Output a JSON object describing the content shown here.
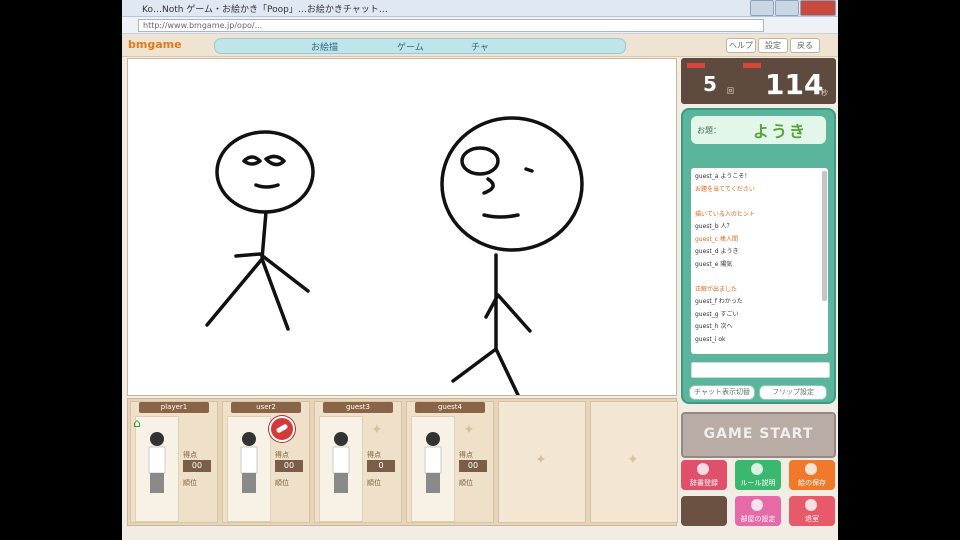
{
  "browser": {
    "title": "Ko…Noth ゲーム・お絵かき「Poop」…お絵かきチャット…",
    "url": "http://www.bmgame.jp/opo/..."
  },
  "site": {
    "logo": "bmgame",
    "nav": [
      "お絵描",
      "ゲーム",
      "チャ"
    ],
    "top_buttons": [
      "ヘルプ",
      "設定",
      "戻る"
    ]
  },
  "game": {
    "round": "5",
    "round_unit": "回",
    "timer": "114",
    "timer_unit": "秒",
    "theme_label": "お題：",
    "theme_word": "ようき",
    "start_label": "GAME START"
  },
  "players": [
    {
      "name": "player1",
      "score": "00",
      "label_top": "得点",
      "label_bot": "順位"
    },
    {
      "name": "user2",
      "score": "00",
      "label_top": "得点",
      "label_bot": "順位"
    },
    {
      "name": "guest3",
      "score": "0",
      "label_top": "得点",
      "label_bot": "順位"
    },
    {
      "name": "guest4",
      "score": "00",
      "label_top": "得点",
      "label_bot": "順位"
    }
  ],
  "chat": [
    {
      "name": "guest_a",
      "text": "ようこそ！",
      "color": "#333333"
    },
    {
      "name": "",
      "text": "お題を当ててください",
      "color": "#e06a1a"
    },
    {
      "name": "",
      "text": "",
      "color": "#e06a1a"
    },
    {
      "name": "",
      "text": "描いている人のヒント",
      "color": "#e06a1a"
    },
    {
      "name": "guest_b",
      "text": "人？",
      "color": "#333333"
    },
    {
      "name": "guest_c",
      "text": "棒人間",
      "color": "#e06a1a"
    },
    {
      "name": "guest_d",
      "text": "ようき",
      "color": "#333333"
    },
    {
      "name": "guest_e",
      "text": "陽気",
      "color": "#333333"
    },
    {
      "name": "",
      "text": "",
      "color": "#e06a1a"
    },
    {
      "name": "",
      "text": "正解が出ました",
      "color": "#e06a1a"
    },
    {
      "name": "guest_f",
      "text": "わかった",
      "color": "#333333"
    },
    {
      "name": "guest_g",
      "text": "すごい",
      "color": "#333333"
    },
    {
      "name": "guest_h",
      "text": "次へ",
      "color": "#333333"
    },
    {
      "name": "guest_i",
      "text": "ok",
      "color": "#333333"
    }
  ],
  "chat_buttons": [
    "チャット表示切替",
    "フリップ設定"
  ],
  "actions": [
    {
      "label": "辞書登録",
      "color": "#e0506a"
    },
    {
      "label": "ルール説明",
      "color": "#3ab86e"
    },
    {
      "label": "絵の保存",
      "color": "#f07a2a"
    },
    {
      "label": "部屋の設定",
      "color": "#e66aa8"
    },
    {
      "label": "退室",
      "color": "#e65a6a"
    }
  ],
  "colors": {
    "canvas_ink": "#111111",
    "accent": "#5ab59c",
    "brand": "#e07a1b"
  }
}
